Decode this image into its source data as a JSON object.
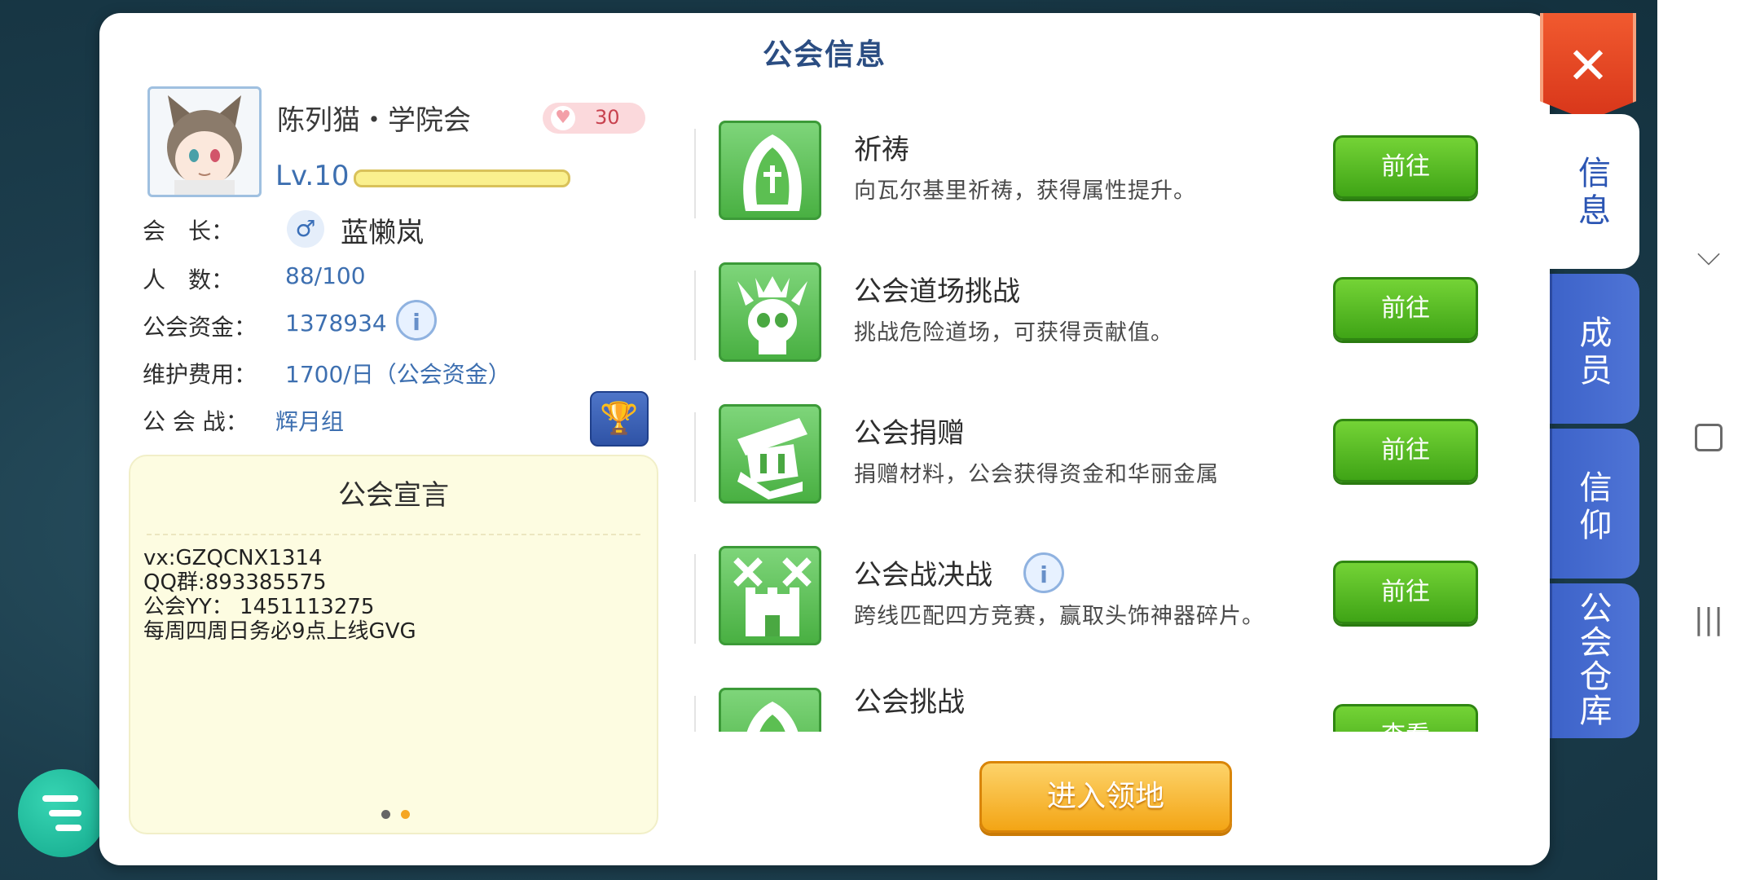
{
  "panel": {
    "title": "公会信息",
    "close_label": "✕"
  },
  "guild": {
    "name": "陈列猫・学院会",
    "hearts": "30",
    "level": "Lv.10",
    "level_progress": 1.0,
    "leader_label": "会　长：",
    "leader_name": "蓝懒岚",
    "members_label": "人　数：",
    "members": "88/100",
    "funds_label": "公会资金：",
    "funds": "1378934",
    "upkeep_label": "维护费用：",
    "upkeep": "1700/日（公会资金）",
    "war_label": "公 会 战：",
    "war_group": "辉月组"
  },
  "manifesto": {
    "title": "公会宣言",
    "lines": [
      "vx:GZQCNX1314",
      "QQ群:893385575",
      "公会YY： 1451113275",
      "每周四周日务必9点上线GVG"
    ],
    "page_dots": 2,
    "active_dot": 1
  },
  "activities": [
    {
      "title": "祈祷",
      "desc": "向瓦尔基里祈祷，获得属性提升。",
      "button": "前往",
      "icon": "prayer-icon"
    },
    {
      "title": "公会道场挑战",
      "desc": "挑战危险道场，可获得贡献值。",
      "button": "前往",
      "icon": "skull-icon"
    },
    {
      "title": "公会捐赠",
      "desc": "捐赠材料，公会获得资金和华丽金属",
      "button": "前往",
      "icon": "donation-icon"
    },
    {
      "title": "公会战决战",
      "desc": "跨线匹配四方竞赛，赢取头饰神器碎片。",
      "button": "前往",
      "icon": "castle-battle-icon"
    },
    {
      "title": "公会挑战",
      "desc": "",
      "button": "查看",
      "icon": "prayer-icon"
    }
  ],
  "enter_button": "进入领地",
  "tabs": [
    {
      "label": "信息",
      "active": true
    },
    {
      "label": "成员",
      "active": false
    },
    {
      "label": "信仰",
      "active": false
    },
    {
      "label": "公会仓库",
      "active": false
    }
  ],
  "colors": {
    "accent_blue": "#3d6fb0",
    "go_green": "#4fb81f",
    "enter_orange": "#f3a515",
    "close_red": "#e2401f"
  }
}
